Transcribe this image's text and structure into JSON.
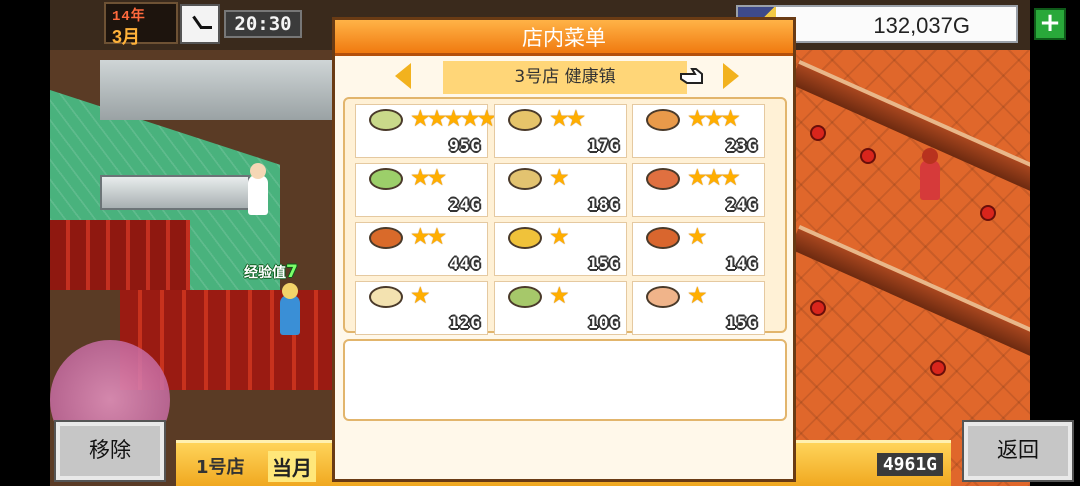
{
  "hud": {
    "year": "14年",
    "month": "3月",
    "time": "20:30",
    "money": "132,037G",
    "add_label": "+"
  },
  "scene": {
    "exp_label": "经验值",
    "exp_value": "7"
  },
  "menu_panel": {
    "title": "店内菜单",
    "shop_name": "3号店 健康镇",
    "description": "",
    "dishes": [
      {
        "stars": 5,
        "price": "95G",
        "plate_color": "#c9d98a"
      },
      {
        "stars": 2,
        "price": "17G",
        "plate_color": "#e6c46a"
      },
      {
        "stars": 3,
        "price": "23G",
        "plate_color": "#e99a4a"
      },
      {
        "stars": 2,
        "price": "24G",
        "plate_color": "#9ccf6a"
      },
      {
        "stars": 1,
        "price": "18G",
        "plate_color": "#e3c370"
      },
      {
        "stars": 3,
        "price": "24G",
        "plate_color": "#e07040"
      },
      {
        "stars": 2,
        "price": "44G",
        "plate_color": "#d96a2a"
      },
      {
        "stars": 1,
        "price": "15G",
        "plate_color": "#f0c23a"
      },
      {
        "stars": 1,
        "price": "14G",
        "plate_color": "#d9662e"
      },
      {
        "stars": 1,
        "price": "12G",
        "plate_color": "#f3e2b0"
      },
      {
        "stars": 1,
        "price": "10G",
        "plate_color": "#a6c86a"
      },
      {
        "stars": 1,
        "price": "15G",
        "plate_color": "#f0b48a"
      }
    ]
  },
  "bottom": {
    "shop_label": "1号店",
    "period_label": "当月",
    "points": "4961G",
    "remove_label": "移除",
    "back_label": "返回"
  },
  "colors": {
    "accent_orange": "#f07a10",
    "star_gold": "#ffae00",
    "floor_red": "#e0672b"
  }
}
